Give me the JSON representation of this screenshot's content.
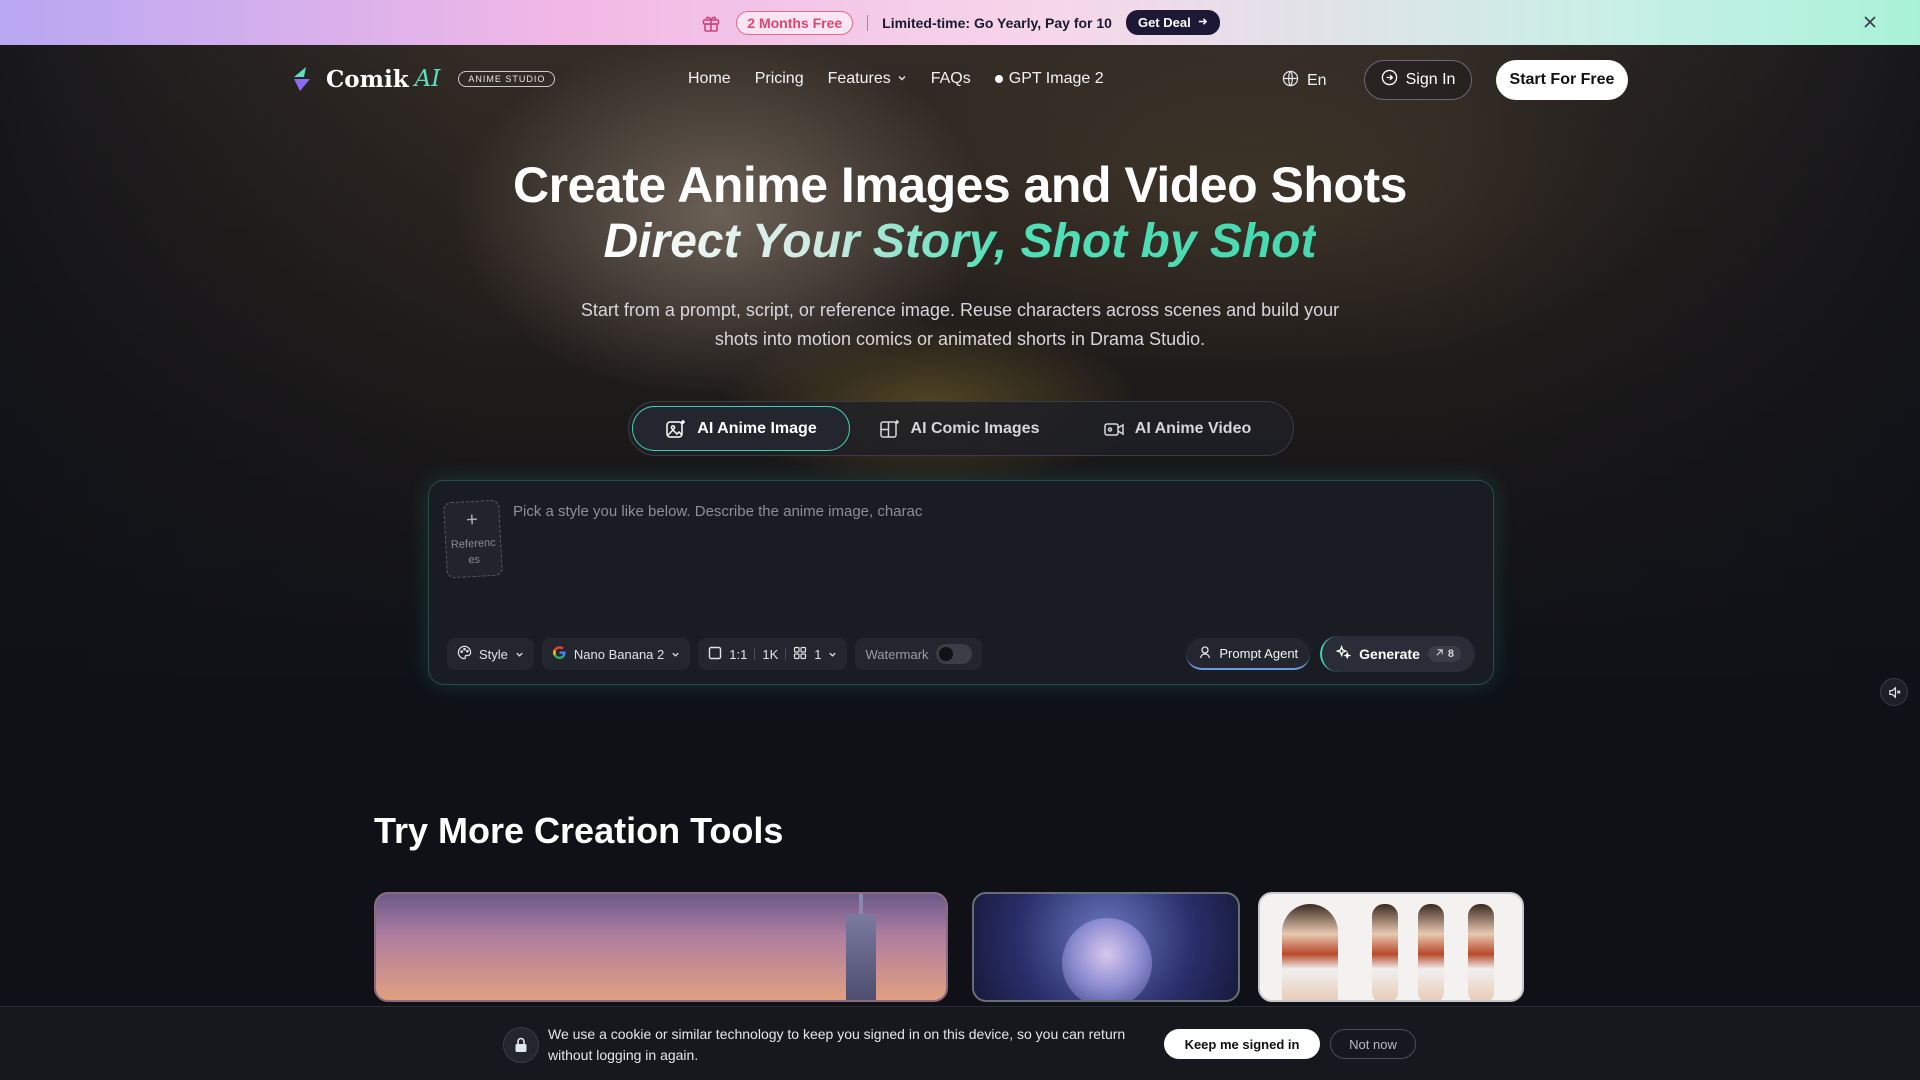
{
  "promo": {
    "badge": "2 Months Free",
    "text": "Limited-time: Go Yearly, Pay for 10",
    "cta": "Get Deal"
  },
  "nav": {
    "brand": "Comik",
    "brand_ai": "AI",
    "brand_tag": "ANIME STUDIO",
    "links": [
      "Home",
      "Pricing",
      "Features",
      "FAQs",
      "GPT Image 2"
    ],
    "language": "En",
    "sign_in": "Sign In",
    "start": "Start For Free"
  },
  "hero": {
    "title": "Create Anime Images and Video Shots",
    "subtitle": "Direct Your Story, Shot by Shot",
    "description": "Start from a prompt, script, or reference image. Reuse characters across scenes and build your shots into motion comics or animated shorts in Drama Studio."
  },
  "tabs": [
    {
      "label": "AI Anime Image",
      "active": true
    },
    {
      "label": "AI Comic Images",
      "active": false
    },
    {
      "label": "AI Anime Video",
      "active": false
    }
  ],
  "prompt": {
    "references_label": "References",
    "placeholder": "Pick a style you like below. Describe the anime image, charac",
    "style": "Style",
    "model": "Nano Banana 2",
    "ratio": "1:1",
    "resolution": "1K",
    "count": "1",
    "watermark": "Watermark",
    "prompt_agent": "Prompt Agent",
    "generate": "Generate",
    "credits": "8"
  },
  "section": {
    "title": "Try More Creation Tools"
  },
  "cookie": {
    "message": "We use a cookie or similar technology to keep you signed in on this device, so you can return without logging in again.",
    "keep": "Keep me signed in",
    "not_now": "Not now"
  },
  "colors": {
    "accent": "#3fd1b0",
    "promo_pink": "#e0456f",
    "background": "#0f1117"
  }
}
